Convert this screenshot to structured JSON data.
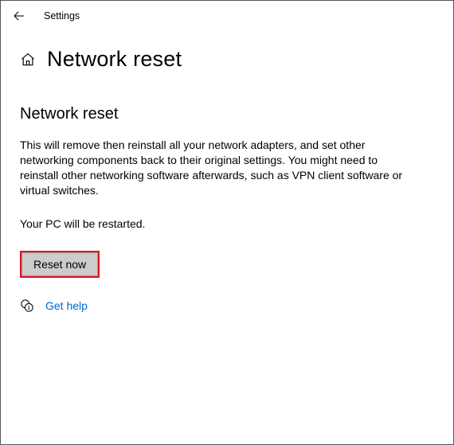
{
  "titlebar": {
    "app_title": "Settings"
  },
  "header": {
    "page_title": "Network reset"
  },
  "content": {
    "section_heading": "Network reset",
    "description": "This will remove then reinstall all your network adapters, and set other networking components back to their original settings. You might need to reinstall other networking software afterwards, such as VPN client software or virtual switches.",
    "restart_notice": "Your PC will be restarted.",
    "reset_button_label": "Reset now",
    "help_link_label": "Get help"
  }
}
